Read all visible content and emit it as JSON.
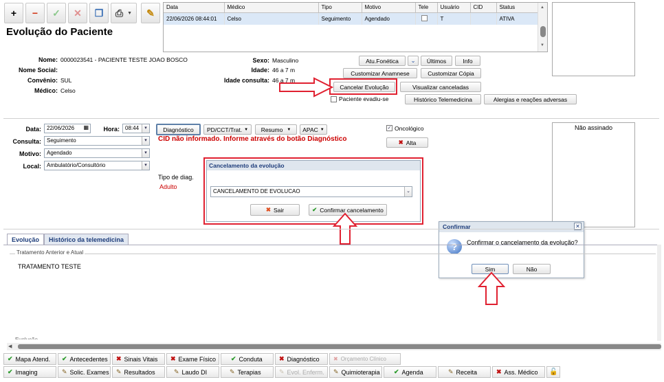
{
  "toolbar": {
    "add": "+",
    "remove": "−",
    "confirm": "✓",
    "cancel": "✕",
    "copy": "❐",
    "print": "⎙",
    "edit": "✎"
  },
  "page_title": "Evolução do Paciente",
  "grid": {
    "headers": [
      "Data",
      "Médico",
      "Tipo",
      "Motivo",
      "Tele",
      "Usuário",
      "CID",
      "Status"
    ],
    "row": [
      "22/06/2026 08:44:01",
      "Celso",
      "Seguimento",
      "Agendado",
      "",
      "T",
      "",
      "ATIVA"
    ]
  },
  "patient": {
    "nome_label": "Nome:",
    "nome": "0000023541 - PACIENTE TESTE JOAO BOSCO",
    "nome_social_label": "Nome Social:",
    "convenio_label": "Convênio:",
    "convenio": "SUL",
    "medico_label": "Médico:",
    "medico": "Celso",
    "sexo_label": "Sexo:",
    "sexo": "Masculino",
    "idade_label": "Idade:",
    "idade": "46 a 7 m",
    "idade_consulta_label": "Idade consulta:",
    "idade_consulta": "46 a 7 m"
  },
  "actions": {
    "atu_fonetica": "Atu.Fonética",
    "ultimos": "Últimos",
    "info": "Info",
    "customizar_anamnese": "Customizar Anamnese",
    "customizar_copia": "Customizar Cópia",
    "cancelar_evolucao": "Cancelar Evolução",
    "visualizar_canceladas": "Visualizar canceladas",
    "paciente_evadiu": "Paciente evadiu-se",
    "historico_telemedicina": "Histórico Telemedicina",
    "alergias": "Alergias e reações adversas"
  },
  "form": {
    "data_label": "Data:",
    "data": "22/06/2026",
    "hora_label": "Hora:",
    "hora": "08:44",
    "consulta_label": "Consulta:",
    "consulta": "Seguimento",
    "motivo_label": "Motivo:",
    "motivo": "Agendado",
    "local_label": "Local:",
    "local": "Ambulatório/Consultório",
    "tipo_diag_label": "Tipo de diag.",
    "tipo_diag": "Adulto"
  },
  "mid_tabs": {
    "diagnostico": "Diagnóstico",
    "pd": "PD/CCT/Trat.",
    "resumo": "Resumo",
    "apac": "APAC"
  },
  "cid_warning": "CID não informado. Informe através do botão Diagnóstico",
  "oncologico_label": "Oncológico",
  "alta_label": "Alta",
  "nao_assinado": "Não assinado",
  "cancel_dialog": {
    "title": "Cancelamento da evolução",
    "reason": "CANCELAMENTO DE EVOLUCAO",
    "sair": "Sair",
    "confirmar": "Confirmar cancelamento"
  },
  "confirm_dialog": {
    "title": "Confirmar",
    "message": "Confirmar o cancelamento da evolução?",
    "sim": "Sim",
    "nao": "Não"
  },
  "bottom_tabs": {
    "evolucao": "Evolução",
    "historico": "Histórico da telemedicina"
  },
  "tratamento": {
    "legend": "Tratamento Anterior e Atual",
    "text": "TRATAMENTO TESTE",
    "cut_label": "Evolução"
  },
  "bottom_row1": [
    "Mapa Atend.",
    "Antecedentes",
    "Sinais Vitais",
    "Exame Físico",
    "Conduta",
    "Diagnóstico",
    "Orçamento Clínico"
  ],
  "bottom_row2": [
    "Imaging",
    "Solic. Exames",
    "Resultados",
    "Laudo DI",
    "Terapias",
    "Evol. Enferm.",
    "Quimioterapia",
    "Agenda",
    "Receita",
    "Ass. Médico"
  ]
}
